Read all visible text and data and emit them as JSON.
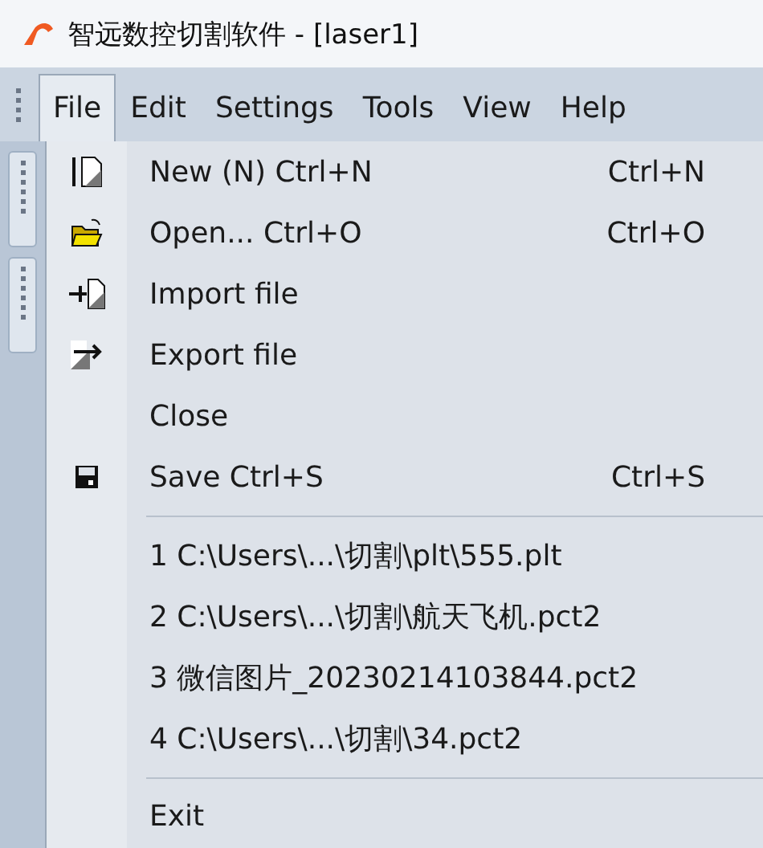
{
  "window": {
    "title": "智远数控切割软件 - [laser1]"
  },
  "menu_bar": [
    {
      "label": "File",
      "selected": true
    },
    {
      "label": "Edit",
      "selected": false
    },
    {
      "label": "Settings",
      "selected": false
    },
    {
      "label": "Tools",
      "selected": false
    },
    {
      "label": "View",
      "selected": false
    },
    {
      "label": "Help",
      "selected": false
    }
  ],
  "file_menu": [
    {
      "kind": "command",
      "label": "New (N) Ctrl+N",
      "shortcut": "Ctrl+N"
    },
    {
      "kind": "command",
      "label": "Open... Ctrl+O",
      "shortcut": "Ctrl+O"
    },
    {
      "kind": "command",
      "label": "Import file"
    },
    {
      "kind": "command",
      "label": "Export file"
    },
    {
      "kind": "command",
      "label": "Close"
    },
    {
      "kind": "command",
      "label": "Save Ctrl+S",
      "shortcut": "Ctrl+S"
    },
    {
      "kind": "separator"
    },
    {
      "kind": "recent",
      "label": "1 C:\\Users\\...\\切割\\plt\\555.plt"
    },
    {
      "kind": "recent",
      "label": "2 C:\\Users\\...\\切割\\航天飞机.pct2"
    },
    {
      "kind": "recent",
      "label": "3 微信图片_20230214103844.pct2"
    },
    {
      "kind": "recent",
      "label": "4 C:\\Users\\...\\切割\\34.pct2"
    },
    {
      "kind": "separator"
    },
    {
      "kind": "command",
      "label": "Exit"
    }
  ]
}
